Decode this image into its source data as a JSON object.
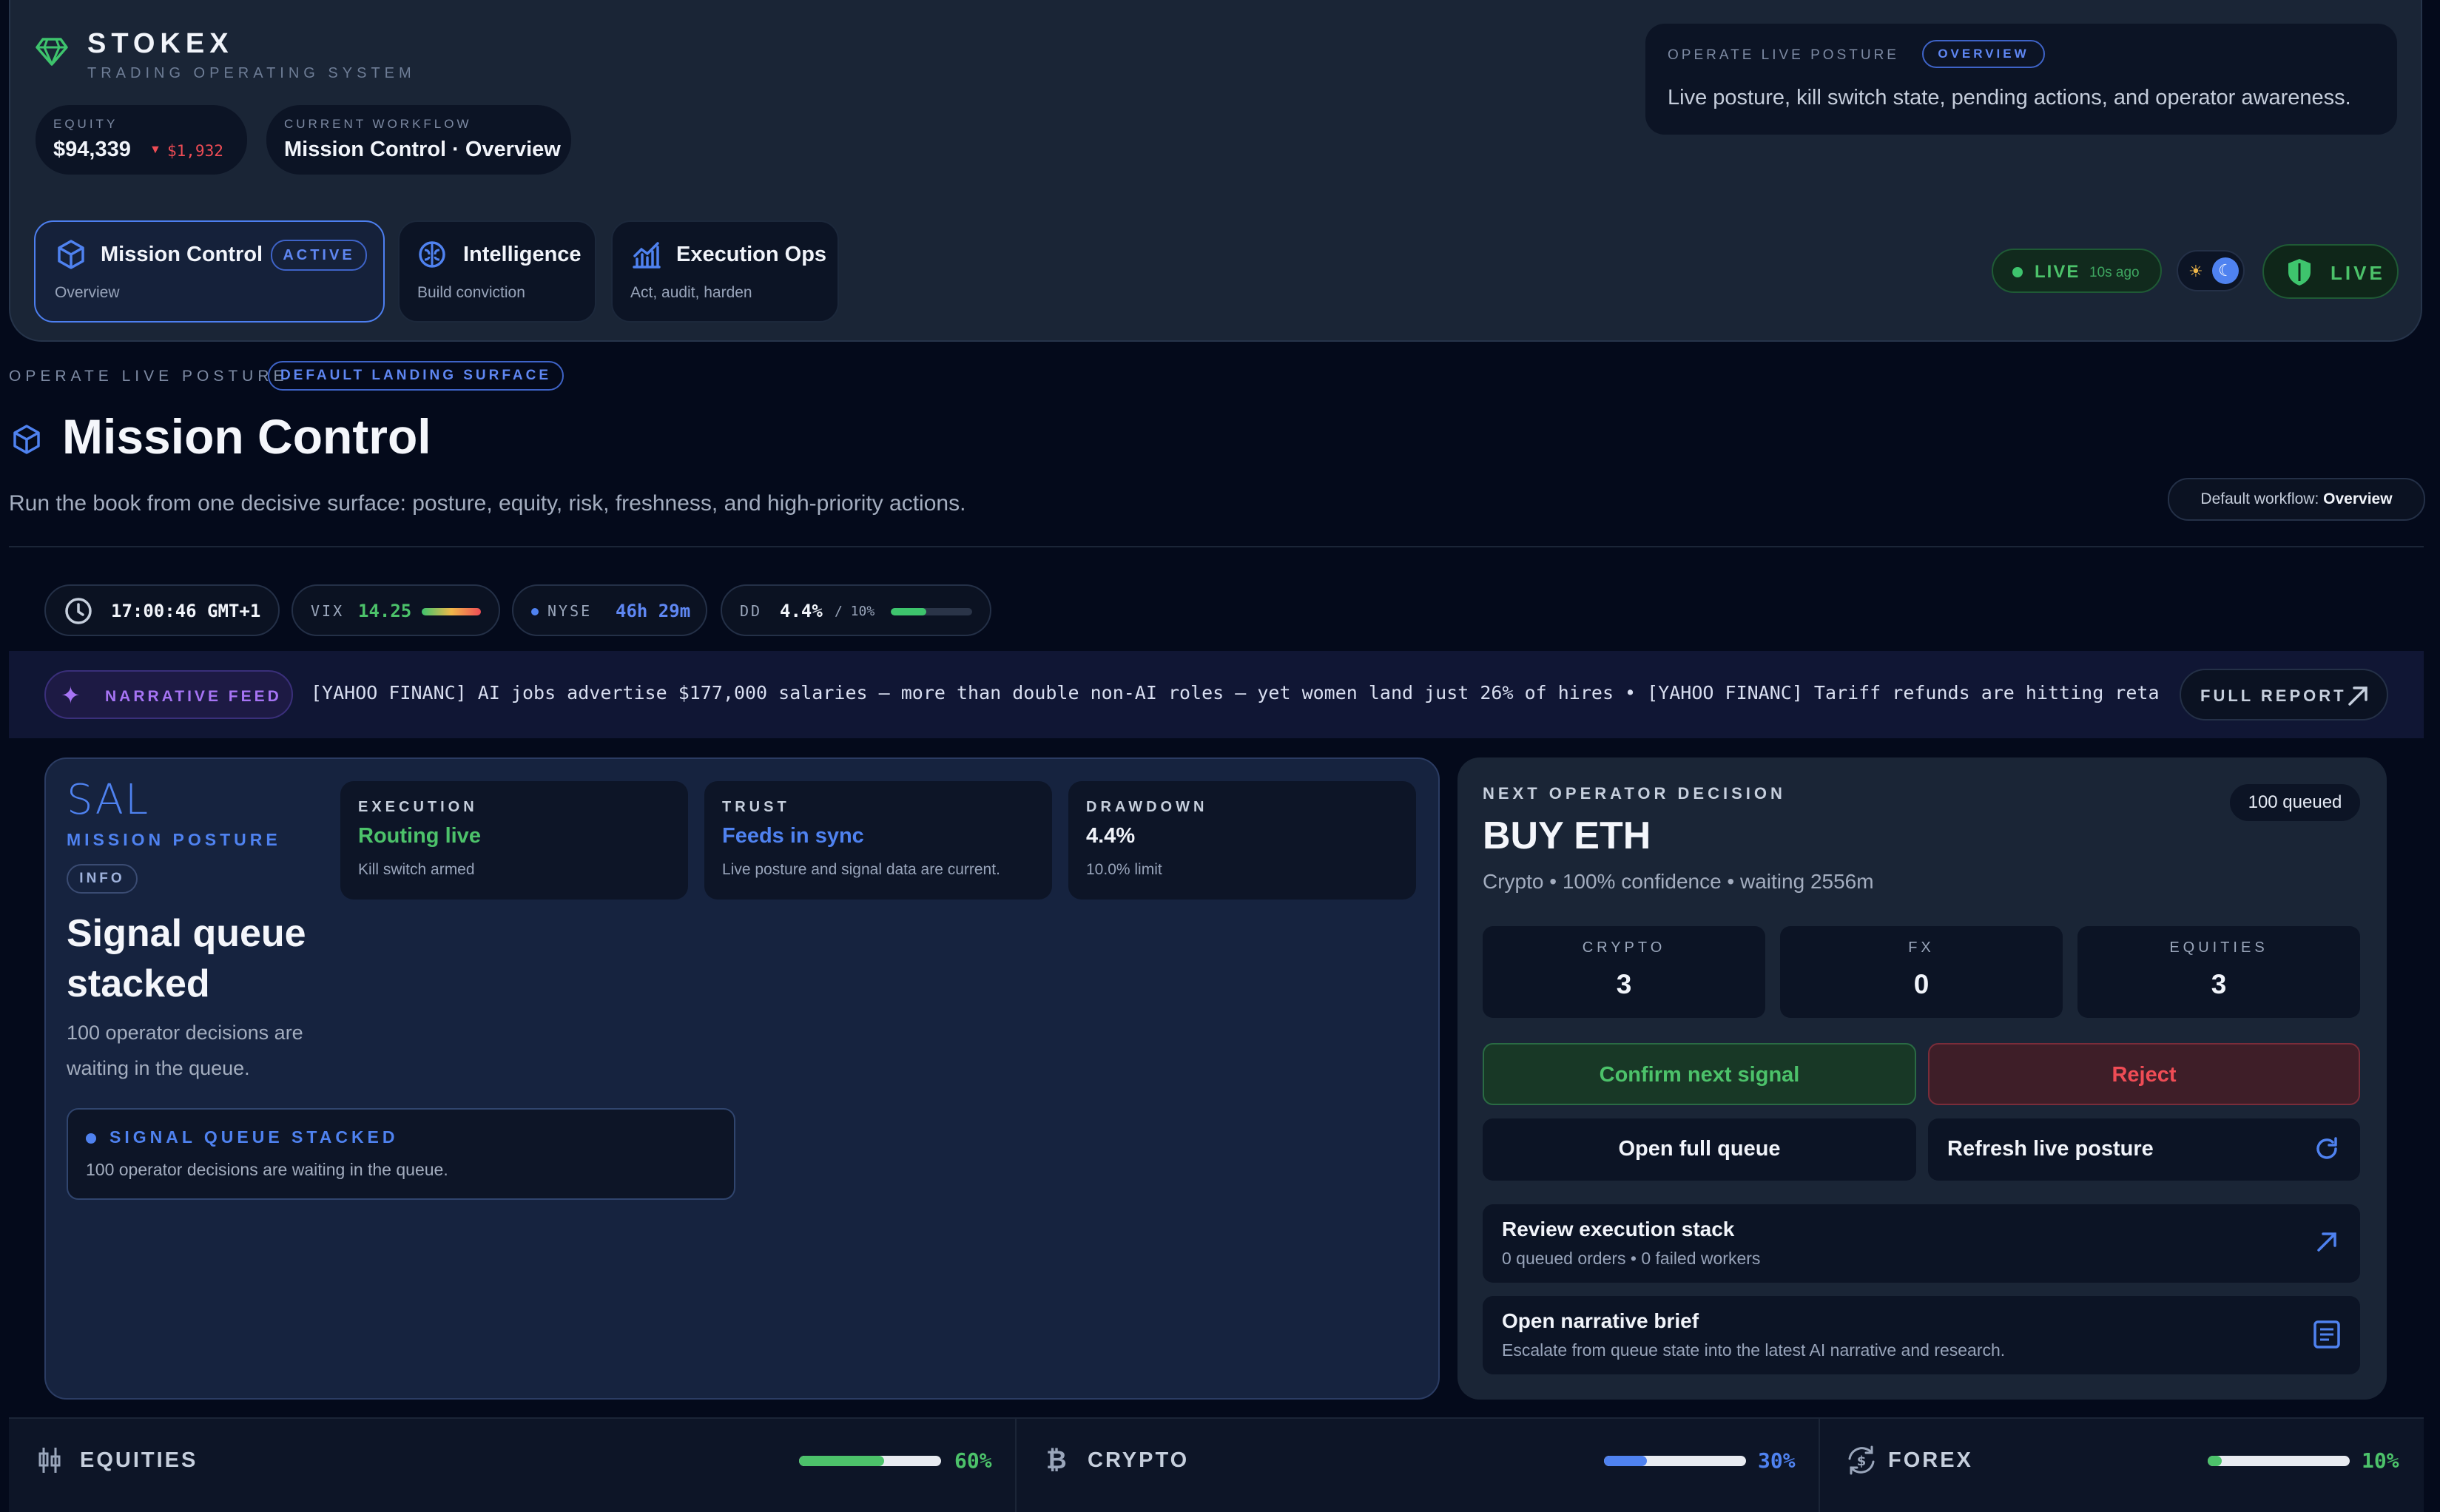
{
  "brand": {
    "name": "STOKEX",
    "subtitle": "TRADING OPERATING SYSTEM"
  },
  "equity": {
    "label": "EQUITY",
    "value": "$94,339",
    "change": "$1,932"
  },
  "workflow": {
    "label": "CURRENT WORKFLOW",
    "value": "Mission Control · Overview"
  },
  "header_desc": {
    "eyebrow": "OPERATE LIVE POSTURE",
    "badge": "OVERVIEW",
    "text": "Live posture, kill switch state, pending actions, and operator awareness."
  },
  "tabs": [
    {
      "title": "Mission Control",
      "badge": "ACTIVE",
      "subtitle": "Overview"
    },
    {
      "title": "Intelligence",
      "subtitle": "Build conviction"
    },
    {
      "title": "Execution Ops",
      "subtitle": "Act, audit, harden"
    }
  ],
  "status": {
    "live": "LIVE",
    "ago": "10s ago",
    "shield": "LIVE"
  },
  "page": {
    "eyebrow": "OPERATE LIVE POSTURE",
    "eyebrow_badge": "DEFAULT LANDING SURFACE",
    "title": "Mission Control",
    "description": "Run the book from one decisive surface: posture, equity, risk, freshness, and high-priority actions.",
    "default_workflow_label": "Default workflow:",
    "default_workflow_value": "Overview"
  },
  "stats": {
    "time": "17:00:46 GMT+1",
    "vix_label": "VIX",
    "vix_value": "14.25",
    "nyse_label": "NYSE",
    "nyse_value": "46h 29m",
    "dd_label": "DD",
    "dd_value": "4.4%",
    "dd_limit": "/ 10%",
    "dd_fill": 0.44
  },
  "narrative": {
    "label": "NARRATIVE FEED",
    "text": "[YAHOO FINANC] AI jobs advertise $177,000 salaries — more than double non-AI roles — yet women land just 26% of hires  •  [YAHOO FINANC] Tariff refunds are hitting retailers' walle",
    "button": "FULL REPORT"
  },
  "posture": {
    "logo": "SAL",
    "label": "MISSION POSTURE",
    "badge": "INFO",
    "title": "Signal queue stacked",
    "desc": "100 operator decisions are waiting in the queue.",
    "alert_title": "SIGNAL QUEUE STACKED",
    "alert_desc": "100 operator decisions are waiting in the queue.",
    "cards": [
      {
        "label": "EXECUTION",
        "value": "Routing live",
        "sub": "Kill switch armed",
        "color": "#4cc26a"
      },
      {
        "label": "TRUST",
        "value": "Feeds in sync",
        "sub": "Live posture and signal data are current.",
        "color": "#4f82f0"
      },
      {
        "label": "DRAWDOWN",
        "value": "4.4%",
        "sub": "10.0% limit",
        "color": "#f1f4fa"
      }
    ]
  },
  "decision": {
    "label": "NEXT OPERATOR DECISION",
    "queued": "100 queued",
    "title": "BUY ETH",
    "meta": "Crypto • 100% confidence • waiting 2556m",
    "counts": [
      {
        "label": "CRYPTO",
        "value": "3"
      },
      {
        "label": "FX",
        "value": "0"
      },
      {
        "label": "EQUITIES",
        "value": "3"
      }
    ],
    "confirm": "Confirm next signal",
    "reject": "Reject",
    "open_queue": "Open full queue",
    "refresh": "Refresh live posture",
    "rows": [
      {
        "title": "Review execution stack",
        "sub": "0 queued orders • 0 failed workers"
      },
      {
        "title": "Open narrative brief",
        "sub": "Escalate from queue state into the latest AI narrative and research."
      }
    ]
  },
  "allocation": [
    {
      "name": "EQUITIES",
      "pct": "60%",
      "fill": 0.6,
      "color": "#4cc26a"
    },
    {
      "name": "CRYPTO",
      "pct": "30%",
      "fill": 0.3,
      "color": "#4f82f0"
    },
    {
      "name": "FOREX",
      "pct": "10%",
      "fill": 0.1,
      "color": "#4cc26a"
    }
  ]
}
